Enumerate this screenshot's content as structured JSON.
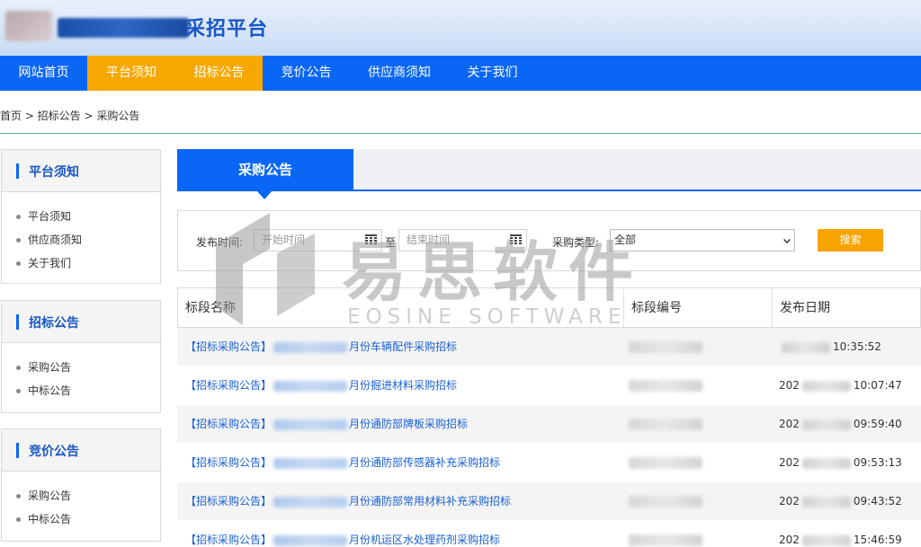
{
  "header": {
    "logo_suffix": "采招平台"
  },
  "nav": [
    {
      "label": "网站首页",
      "active": false
    },
    {
      "label": "平台须知",
      "active": true
    },
    {
      "label": "招标公告",
      "active": true
    },
    {
      "label": "竞价公告",
      "active": false
    },
    {
      "label": "供应商须知",
      "active": false
    },
    {
      "label": "关于我们",
      "active": false
    }
  ],
  "breadcrumb": "首页 > 招标公告 > 采购公告",
  "sidebar": [
    {
      "title": "平台须知",
      "items": [
        "平台须知",
        "供应商须知",
        "关于我们"
      ]
    },
    {
      "title": "招标公告",
      "items": [
        "采购公告",
        "中标公告"
      ]
    },
    {
      "title": "竞价公告",
      "items": [
        "采购公告",
        "中标公告"
      ]
    }
  ],
  "tab": {
    "label": "采购公告"
  },
  "search": {
    "publish_time_label": "发布时间:",
    "start_placeholder": "开始时间",
    "to_label": "至",
    "end_placeholder": "结束时间",
    "type_label": "采购类型:",
    "type_value": "全部",
    "button_label": "搜索"
  },
  "table": {
    "headers": [
      "标段名称",
      "标段编号",
      "发布日期"
    ],
    "rows": [
      {
        "prefix": "【招标采购公告】",
        "name": "月份车辆配件采购招标",
        "date_prefix": "",
        "time": "10:35:52"
      },
      {
        "prefix": "【招标采购公告】",
        "name": "月份掘进材料采购招标",
        "date_prefix": "202",
        "time": "10:07:47"
      },
      {
        "prefix": "【招标采购公告】",
        "name": "月份通防部牌板采购招标",
        "date_prefix": "202",
        "time": "09:59:40"
      },
      {
        "prefix": "【招标采购公告】",
        "name": "月份通防部传感器补充采购招标",
        "date_prefix": "202",
        "time": "09:53:13"
      },
      {
        "prefix": "【招标采购公告】",
        "name": "月份通防部常用材料补充采购招标",
        "date_prefix": "202",
        "time": "09:43:52"
      },
      {
        "prefix": "【招标采购公告】",
        "name": "月份机运区水处理药剂采购招标",
        "date_prefix": "202",
        "time": "15:46:59"
      }
    ]
  },
  "watermark": {
    "cn": "易思软件",
    "en": "EOSINE SOFTWARE"
  },
  "colors": {
    "primary": "#0a66f5",
    "accent": "#f7a800",
    "link": "#1a5fd6"
  }
}
